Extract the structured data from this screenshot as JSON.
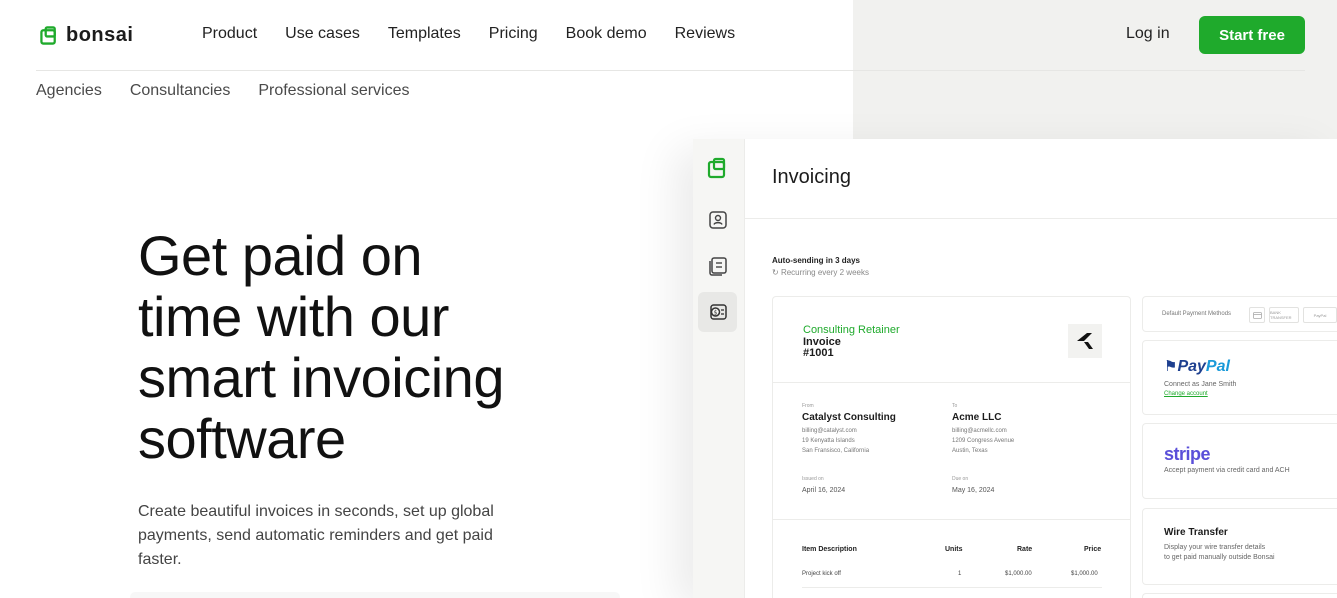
{
  "brand": {
    "name": "bonsai",
    "accent": "#1faa2c"
  },
  "nav": {
    "items": [
      "Product",
      "Use cases",
      "Templates",
      "Pricing",
      "Book demo",
      "Reviews"
    ],
    "login_label": "Log in",
    "start_label": "Start free"
  },
  "subnav": {
    "items": [
      "Agencies",
      "Consultancies",
      "Professional services"
    ]
  },
  "hero": {
    "title_lines": [
      "Get paid on",
      "time with our",
      "smart invoicing",
      "software"
    ],
    "description_lines": [
      "Create beautiful invoices in seconds, set up global",
      "payments, send automatic reminders and get paid",
      "faster."
    ]
  },
  "app": {
    "title": "Invoicing",
    "sidebar_icons": [
      "bonsai-logo-icon",
      "contacts-icon",
      "documents-icon",
      "invoicing-icon"
    ],
    "auto_sending": "Auto-sending in 3 days",
    "recurring": "Recurring every 2 weeks",
    "invoice": {
      "retainer": "Consulting Retainer",
      "label": "Invoice",
      "number": "#1001",
      "from_label": "From",
      "from_name": "Catalyst Consulting",
      "from_lines": [
        "billing@catalyst.com",
        "19 Kenyatta Islands",
        "San Fransisco, California"
      ],
      "to_label": "To",
      "to_name": "Acme LLC",
      "to_lines": [
        "billing@acmellc.com",
        "1209 Congress Avenue",
        "Austin, Texas"
      ],
      "issued_label": "Issued on",
      "issued_date": "April 16, 2024",
      "due_label": "Due on",
      "due_date": "May 16, 2024",
      "columns": [
        "Item Description",
        "Units",
        "Rate",
        "Price"
      ],
      "rows": [
        {
          "description": "Project kick off",
          "units": "1",
          "rate": "$1,000.00",
          "price": "$1,000.00"
        }
      ]
    },
    "payments": {
      "header_label": "Default Payment Methods",
      "chips": [
        "BANK TRANSFER",
        "PayPal"
      ],
      "paypal": {
        "logo_a": "Pay",
        "logo_b": "Pal",
        "connect_text": "Connect as Jane Smith",
        "change_link": "Change account"
      },
      "stripe": {
        "logo": "stripe",
        "text": "Accept payment via credit card and ACH"
      },
      "wire": {
        "title": "Wire Transfer",
        "line1": "Display your wire transfer details",
        "line2": "to get paid manually outside Bonsai"
      }
    }
  }
}
